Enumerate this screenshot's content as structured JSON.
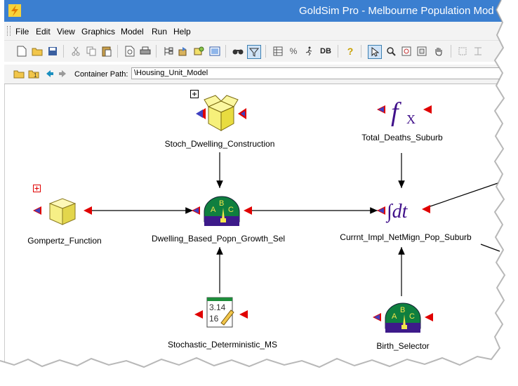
{
  "window": {
    "title": "GoldSim Pro - Melbourne Population Mod"
  },
  "menu": {
    "items": [
      "File",
      "Edit",
      "View",
      "Graphics",
      "Model",
      "Run",
      "Help"
    ]
  },
  "path_bar": {
    "label": "Container Path:",
    "value": "\\Housing_Unit_Model"
  },
  "toolbar": {
    "db_label": "DB"
  },
  "nodes": {
    "stoch_dwelling": {
      "label": "Stoch_Dwelling_Construction"
    },
    "total_deaths": {
      "label": "Total_Deaths_Suburb",
      "glyph": "f",
      "glyph_sub": "X"
    },
    "gompertz": {
      "label": "Gompertz_Function"
    },
    "dwelling_selector": {
      "label": "Dwelling_Based_Popn_Growth_Sel",
      "dial_letters": [
        "A",
        "B",
        "C"
      ]
    },
    "currnt_impl": {
      "label": "Currnt_Impl_NetMign_Pop_Suburb",
      "glyph": "∫dt"
    },
    "stochastic_det": {
      "label": "Stochastic_Deterministic_MS",
      "value_top": "3.14",
      "value_bottom": "16"
    },
    "birth_selector": {
      "label": "Birth_Selector",
      "dial_letters": [
        "A",
        "B",
        "C"
      ]
    }
  },
  "colors": {
    "titlebar": "#3b7fd0",
    "port_red": "#e00000",
    "port_blue": "#4040c0",
    "integrator": "#40108a",
    "dial_green": "#0f7f3f",
    "dial_base": "#3d1a8a",
    "cube_yellow": "#f6f07a"
  }
}
